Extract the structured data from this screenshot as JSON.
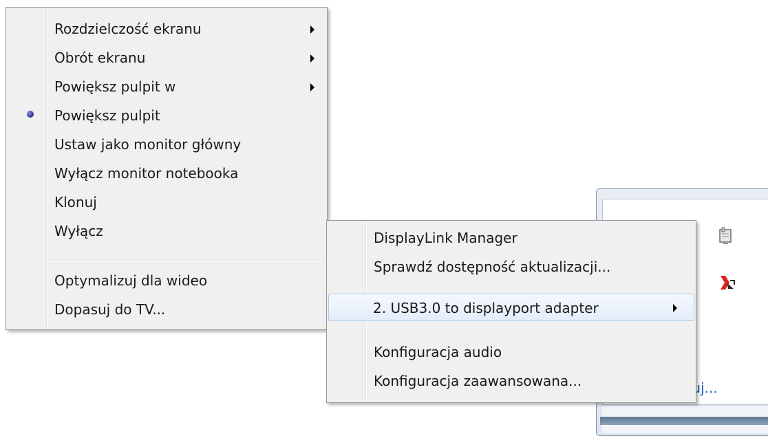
{
  "main_menu": {
    "items": [
      {
        "label": "Rozdzielczość ekranu",
        "submenu": true
      },
      {
        "label": "Obrót ekranu",
        "submenu": true
      },
      {
        "label": "Powiększ pulpit w",
        "submenu": true
      },
      {
        "label": "Powiększ pulpit",
        "checked": true
      },
      {
        "label": "Ustaw jako monitor główny"
      },
      {
        "label": "Wyłącz monitor notebooka"
      },
      {
        "label": "Klonuj"
      },
      {
        "label": "Wyłącz"
      },
      {
        "label": "Optymalizuj dla wideo"
      },
      {
        "label": "Dopasuj do TV..."
      }
    ]
  },
  "sub_menu": {
    "items": [
      {
        "label": "DisplayLink Manager"
      },
      {
        "label": "Sprawdź dostępność aktualizacji..."
      },
      {
        "label": "2. USB3.0 to displayport adapter",
        "submenu": true,
        "highlighted": true
      },
      {
        "label": "Konfiguracja audio"
      },
      {
        "label": "Konfiguracja zaawansowana..."
      }
    ]
  },
  "tray": {
    "customize_label": "suj..."
  },
  "colors": {
    "menu_bg": "#f0f0f0",
    "highlight_border": "#a8c8ec",
    "link": "#1f5fbf"
  }
}
